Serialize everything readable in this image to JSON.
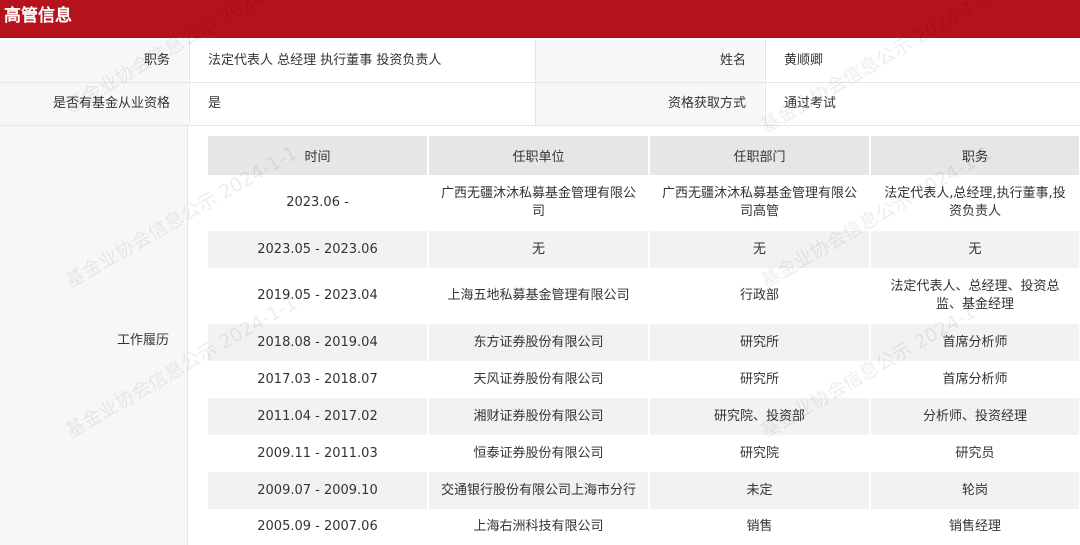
{
  "header": {
    "title": "高管信息"
  },
  "info": {
    "position_label": "职务",
    "position_value": "法定代表人 总经理 执行董事 投资负责人",
    "name_label": "姓名",
    "name_value": "黄顺卿",
    "qualification_label": "是否有基金从业资格",
    "qualification_value": "是",
    "method_label": "资格获取方式",
    "method_value": "通过考试"
  },
  "work_history": {
    "label": "工作履历",
    "columns": [
      "时间",
      "任职单位",
      "任职部门",
      "职务"
    ],
    "rows": [
      {
        "time": "2023.06 -",
        "company": "广西无疆沐沐私募基金管理有限公司",
        "department": "广西无疆沐沐私募基金管理有限公司高管",
        "position": "法定代表人,总经理,执行董事,投资负责人"
      },
      {
        "time": "2023.05 - 2023.06",
        "company": "无",
        "department": "无",
        "position": "无"
      },
      {
        "time": "2019.05 - 2023.04",
        "company": "上海五地私募基金管理有限公司",
        "department": "行政部",
        "position": "法定代表人、总经理、投资总监、基金经理"
      },
      {
        "time": "2018.08 - 2019.04",
        "company": "东方证券股份有限公司",
        "department": "研究所",
        "position": "首席分析师"
      },
      {
        "time": "2017.03 - 2018.07",
        "company": "天风证券股份有限公司",
        "department": "研究所",
        "position": "首席分析师"
      },
      {
        "time": "2011.04 - 2017.02",
        "company": "湘财证券股份有限公司",
        "department": "研究院、投资部",
        "position": "分析师、投资经理"
      },
      {
        "time": "2009.11 - 2011.03",
        "company": "恒泰证券股份有限公司",
        "department": "研究院",
        "position": "研究员"
      },
      {
        "time": "2009.07 - 2009.10",
        "company": "交通银行股份有限公司上海市分行",
        "department": "未定",
        "position": "轮岗"
      },
      {
        "time": "2005.09 - 2007.06",
        "company": "上海右洲科技有限公司",
        "department": "销售",
        "position": "销售经理"
      }
    ]
  },
  "watermark": {
    "text": "基金业协会信息公示 2024-1-1"
  }
}
